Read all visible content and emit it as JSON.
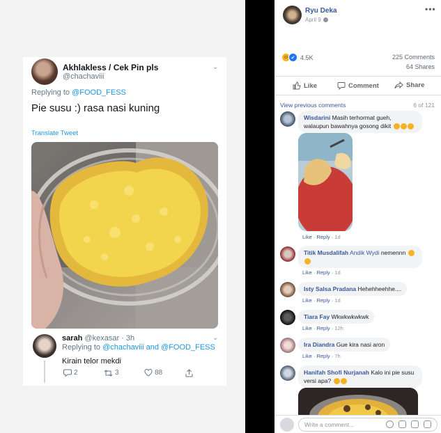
{
  "tweet": {
    "name": "Akhlakless / Cek Pin pls",
    "handle": "@chachaviii",
    "replying_prefix": "Replying to",
    "replying_to": "@FOOD_FESS",
    "text": "Pie susu :) rasa nasi kuning",
    "translate": "Translate Tweet"
  },
  "reply_tweet": {
    "name": "sarah",
    "meta": "@kexasar · 3h",
    "replying_prefix": "Replying to",
    "replying_to": "@chachaviii and @FOOD_FESS",
    "text": "Kirain telor mekdi",
    "reply_count": "2",
    "retweet_count": "3",
    "like_count": "88"
  },
  "fb_post": {
    "author": "Ryu Deka",
    "date": "April 9",
    "reaction_count": "4.5K",
    "comments_count": "225 Comments",
    "shares_count": "64 Shares",
    "actions": {
      "like": "Like",
      "comment": "Comment",
      "share": "Share"
    },
    "view_previous": "View previous comments",
    "pager": "6 of 121",
    "comments": [
      {
        "name": "Wisdarini",
        "text": "Masih terhormat gueh, walaupun bawahnya gosong dikit",
        "like": "Like",
        "reply": "Reply",
        "time": "1d"
      },
      {
        "name": "Titik Musdalifah",
        "tag": "Andik Wydi",
        "text": "nemennn",
        "like": "Like",
        "reply": "Reply",
        "time": "1d"
      },
      {
        "name": "Isty Salsa Pradana",
        "text": "Hehehheehhe....",
        "like": "Like",
        "reply": "Reply",
        "time": "1d"
      },
      {
        "name": "Tiara Fay",
        "text": "Wkwkwkwkwk",
        "like": "Like",
        "reply": "Reply",
        "time": "12h"
      },
      {
        "name": "Ira Diandra",
        "text": "Gue kira nasi aron",
        "like": "Like",
        "reply": "Reply",
        "time": "7h"
      },
      {
        "name": "Hanifah Shofi Nurjanah",
        "text": "Kalo ini pie susu versi apa?"
      }
    ],
    "write_placeholder": "Write a comment..."
  },
  "colors": {
    "fb_link": "#365899",
    "tw_link": "#1b95e0",
    "divider": "#000000"
  },
  "icons": [
    "chevron-down-icon",
    "reply-icon",
    "retweet-icon",
    "heart-icon",
    "share-icon",
    "globe-icon",
    "more-icon",
    "haha-icon",
    "like-icon",
    "thumb-up-icon",
    "comment-icon",
    "share-arrow-icon",
    "emoji-icon",
    "camera-icon",
    "gif-icon",
    "sticker-icon"
  ]
}
